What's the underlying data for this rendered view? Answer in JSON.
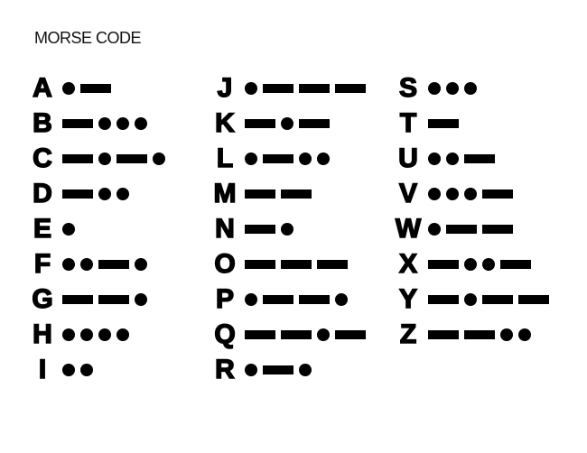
{
  "title": "MORSE CODE",
  "columns": [
    [
      {
        "letter": "A",
        "code": ".-"
      },
      {
        "letter": "B",
        "code": "-..."
      },
      {
        "letter": "C",
        "code": "-.-."
      },
      {
        "letter": "D",
        "code": "-.."
      },
      {
        "letter": "E",
        "code": "."
      },
      {
        "letter": "F",
        "code": "..-."
      },
      {
        "letter": "G",
        "code": "--."
      },
      {
        "letter": "H",
        "code": "...."
      },
      {
        "letter": "I",
        "code": ".."
      }
    ],
    [
      {
        "letter": "J",
        "code": ".---"
      },
      {
        "letter": "K",
        "code": "-.-"
      },
      {
        "letter": "L",
        "code": ".-.."
      },
      {
        "letter": "M",
        "code": "--"
      },
      {
        "letter": "N",
        "code": "-."
      },
      {
        "letter": "O",
        "code": "---"
      },
      {
        "letter": "P",
        "code": ".--."
      },
      {
        "letter": "Q",
        "code": "--.-"
      },
      {
        "letter": "R",
        "code": ".-."
      }
    ],
    [
      {
        "letter": "S",
        "code": "..."
      },
      {
        "letter": "T",
        "code": "-"
      },
      {
        "letter": "U",
        "code": "..-"
      },
      {
        "letter": "V",
        "code": "...-"
      },
      {
        "letter": "W",
        "code": ".--"
      },
      {
        "letter": "X",
        "code": "-..-"
      },
      {
        "letter": "Y",
        "code": "-.--"
      },
      {
        "letter": "Z",
        "code": "--.."
      }
    ]
  ]
}
